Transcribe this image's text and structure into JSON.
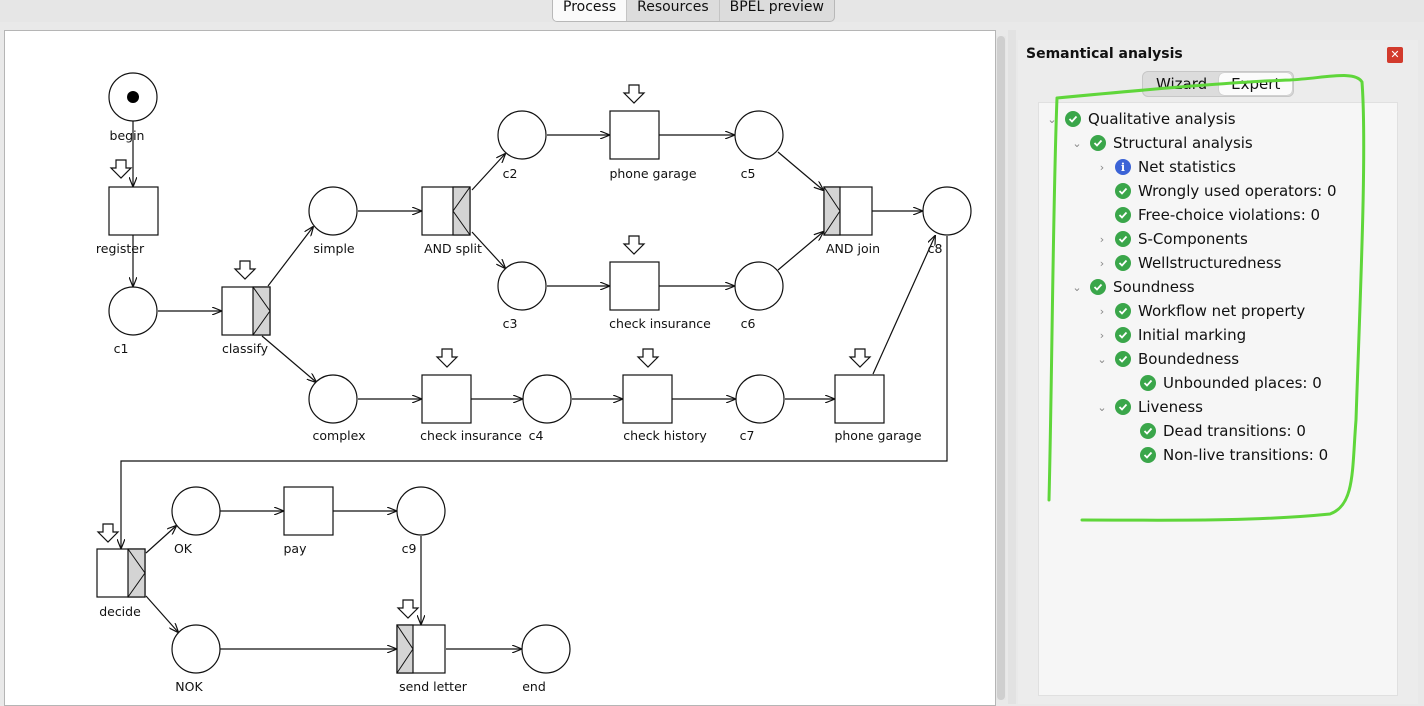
{
  "tabs": [
    "Process",
    "Resources",
    "BPEL preview"
  ],
  "active_tab": 0,
  "diagram": {
    "places": {
      "begin": "begin",
      "c1": "c1",
      "simple": "simple",
      "complex": "complex",
      "c2": "c2",
      "c3": "c3",
      "c4": "c4",
      "c5": "c5",
      "c6": "c6",
      "c7": "c7",
      "c8": "c8",
      "OK": "OK",
      "NOK": "NOK",
      "c9": "c9",
      "end": "end"
    },
    "transitions": {
      "register": "register",
      "classify": "classify",
      "and_split": "AND split",
      "phone_garage_top": "phone garage",
      "check_insurance_mid": "check insurance",
      "and_join": "AND join",
      "check_insurance_low": "check insurance",
      "check_history": "check history",
      "phone_garage_low": "phone garage",
      "decide": "decide",
      "pay": "pay",
      "send_letter": "send letter"
    }
  },
  "panel": {
    "title": "Semantical analysis",
    "tabs": [
      "Wizard",
      "Expert"
    ],
    "active_tab": 1,
    "tree": [
      {
        "label": "Qualitative analysis",
        "icon": "check-icon",
        "level": 0,
        "expanded": true
      },
      {
        "label": "Structural analysis",
        "icon": "check-icon",
        "level": 1,
        "expanded": true
      },
      {
        "label": "Net statistics",
        "icon": "info-icon",
        "level": 2,
        "expanded": false
      },
      {
        "label": "Wrongly used operators: 0",
        "icon": "check-icon",
        "level": 2,
        "leaf": true
      },
      {
        "label": "Free-choice violations: 0",
        "icon": "check-icon",
        "level": 2,
        "leaf": true
      },
      {
        "label": "S-Components",
        "icon": "check-icon",
        "level": 2,
        "expanded": false
      },
      {
        "label": "Wellstructuredness",
        "icon": "check-icon",
        "level": 2,
        "expanded": false
      },
      {
        "label": "Soundness",
        "icon": "check-icon",
        "level": 1,
        "expanded": true
      },
      {
        "label": "Workflow net property",
        "icon": "check-icon",
        "level": 2,
        "expanded": false
      },
      {
        "label": "Initial marking",
        "icon": "check-icon",
        "level": 2,
        "expanded": false
      },
      {
        "label": "Boundedness",
        "icon": "check-icon",
        "level": 2,
        "expanded": true
      },
      {
        "label": "Unbounded places: 0",
        "icon": "check-icon",
        "level": 3,
        "leaf": true
      },
      {
        "label": "Liveness",
        "icon": "check-icon",
        "level": 2,
        "expanded": true
      },
      {
        "label": "Dead transitions: 0",
        "icon": "check-icon",
        "level": 3,
        "leaf": true
      },
      {
        "label": "Non-live transitions: 0",
        "icon": "check-icon",
        "level": 3,
        "leaf": true
      }
    ]
  },
  "colors": {
    "status_ok": "#3aa64a",
    "status_info": "#3b63d6",
    "annotation": "#5fd63a",
    "close": "#d23a2c"
  }
}
